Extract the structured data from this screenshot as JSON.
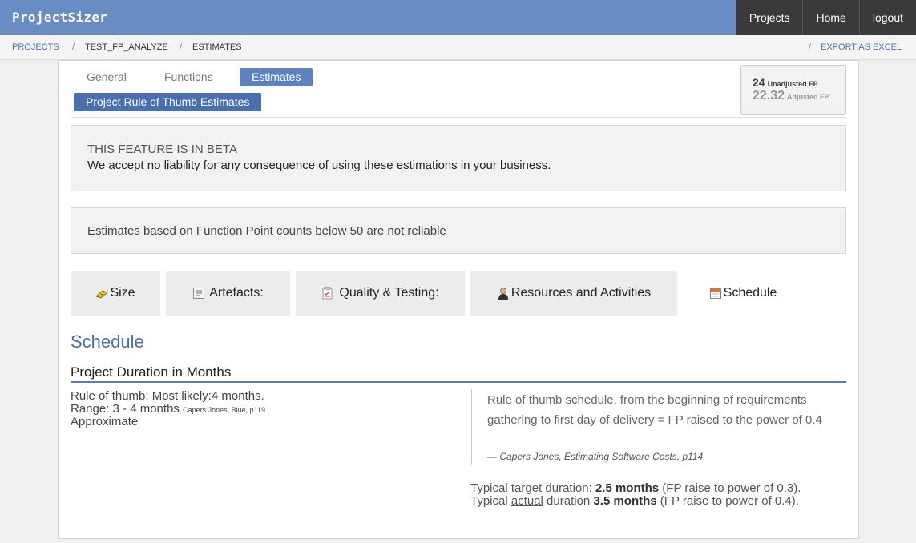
{
  "app": {
    "brand": "ProjectSizer"
  },
  "nav": {
    "projects": "Projects",
    "home": "Home",
    "logout": "logout"
  },
  "breadcrumb": {
    "projects": "PROJECTS",
    "sep": "/",
    "project": "TEST_FP_ANALYZE",
    "estimates": "ESTIMATES",
    "export": "EXPORT AS EXCEL"
  },
  "tabs": {
    "general": "General",
    "functions": "Functions",
    "estimates": "Estimates"
  },
  "subtab": "Project Rule of Thumb Estimates",
  "fp": {
    "unadjusted_value": "24",
    "unadjusted_label": "Unadjusted FP",
    "adjusted_value": "22.32",
    "adjusted_label": "Adjusted FP"
  },
  "beta": {
    "title": "THIS FEATURE IS IN BETA",
    "body": "We accept no liability for any consequence of using these estimations in your business."
  },
  "warning": "Estimates based on Function Point counts below 50 are not reliable",
  "feature_tabs": {
    "size": "Size",
    "artefacts": "Artefacts:",
    "quality": "Quality & Testing:",
    "resources": "Resources and Activities",
    "schedule": "Schedule"
  },
  "schedule": {
    "heading": "Schedule",
    "subheading": "Project Duration in Months",
    "most_likely_prefix": "Rule of thumb: Most likely:",
    "most_likely_value": "4 months.",
    "range_text": "Range: 3 - 4 months",
    "range_source": "Capers Jones, Blue, p119",
    "approx": "Approximate",
    "quote": "Rule of thumb schedule, from the beginning of requirements gathering to first day of delivery = FP raised to the power of 0.4",
    "quote_cite": "— Capers Jones, Estimating Software Costs, p114",
    "typ_target_prefix": "Typical ",
    "typ_target_word": "target",
    "typ_target_mid": " duration: ",
    "typ_target_value": "2.5 months",
    "typ_target_suffix": " (FP raise to power of 0.3).",
    "typ_actual_prefix": "Typical ",
    "typ_actual_word": "actual",
    "typ_actual_mid": " duration ",
    "typ_actual_value": "3.5 months",
    "typ_actual_suffix": " (FP raise to power of 0.4)."
  },
  "icons": {
    "size": "ruler-icon",
    "artefacts": "document-icon",
    "quality": "checklist-icon",
    "resources": "person-icon",
    "schedule": "calendar-icon"
  }
}
